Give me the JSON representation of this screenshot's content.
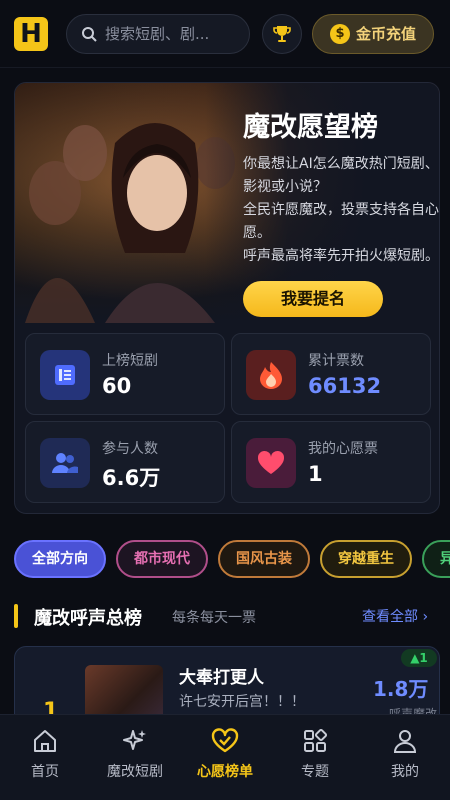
{
  "header": {
    "logo_text": "H",
    "search_placeholder": "搜索短剧、剧...",
    "trophy_icon": "trophy-icon",
    "recharge_label": "金币充值",
    "coin_symbol": "$"
  },
  "hero": {
    "title": "魔改愿望榜",
    "description_lines": [
      "你最想让AI怎么魔改热门短剧、",
      "影视或小说？",
      "全民许愿魔改，投票支持各自心",
      "愿。",
      "呼声最高将率先开拍火爆短剧。"
    ],
    "nominate_label": "我要提名",
    "stats": [
      {
        "label": "上榜短剧",
        "value": "60",
        "icon": "list-icon",
        "value_color": "#ffffff"
      },
      {
        "label": "累计票数",
        "value": "66132",
        "icon": "flame-icon",
        "value_color": "#6f8cff"
      },
      {
        "label": "参与人数",
        "value": "6.6万",
        "icon": "users-icon",
        "value_color": "#ffffff"
      },
      {
        "label": "我的心愿票",
        "value": "1",
        "icon": "heart-icon",
        "value_color": "#ffffff"
      }
    ]
  },
  "filters": [
    {
      "label": "全部方向",
      "active": true
    },
    {
      "label": "都市现代",
      "active": false
    },
    {
      "label": "国风古装",
      "active": false
    },
    {
      "label": "穿越重生",
      "active": false
    },
    {
      "label": "异",
      "active": false
    }
  ],
  "section": {
    "title": "魔改呼声总榜",
    "subtitle": "每条每天一票",
    "more_label": "查看全部 ›"
  },
  "ranking": [
    {
      "rank": "1",
      "title": "大奉打更人",
      "description": "许七安开后宫！！！",
      "votes": "1.8万",
      "change": "▲1",
      "note": "呼声魔改"
    }
  ],
  "nav": [
    {
      "label": "首页",
      "icon": "home-icon",
      "active": false
    },
    {
      "label": "魔改短剧",
      "icon": "sparkle-icon",
      "active": false
    },
    {
      "label": "心愿榜单",
      "icon": "heart-check-icon",
      "active": true
    },
    {
      "label": "专题",
      "icon": "grid-icon",
      "active": false
    },
    {
      "label": "我的",
      "icon": "user-icon",
      "active": false
    }
  ],
  "colors": {
    "accent": "#f5c518",
    "link": "#6f8cff",
    "background": "#0b0d14"
  }
}
